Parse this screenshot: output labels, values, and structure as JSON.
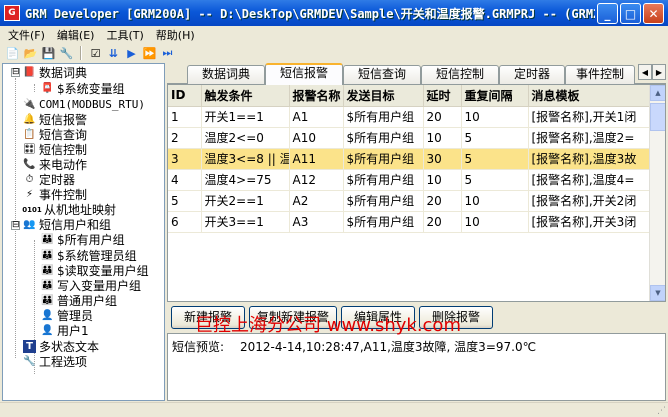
{
  "window": {
    "title": "GRM Developer [GRM200A] -- D:\\DeskTop\\GRMDEV\\Sample\\开关和温度报警.GRMPRJ -- (GRM200...",
    "icon_label": "G",
    "minimize": "_",
    "maximize": "□",
    "close": "✕"
  },
  "menubar": [
    {
      "label": "文件(F)"
    },
    {
      "label": "编辑(E)"
    },
    {
      "label": "工具(T)"
    },
    {
      "label": "帮助(H)"
    }
  ],
  "toolbar": [
    {
      "icon": "new-icon",
      "glyph": "📄"
    },
    {
      "icon": "open-icon",
      "glyph": "📂"
    },
    {
      "icon": "save-icon",
      "glyph": "💾"
    },
    {
      "icon": "tools-icon",
      "glyph": "🔧"
    },
    {
      "icon": "checklist-icon",
      "glyph": "☑"
    },
    {
      "icon": "download-icon",
      "glyph": "⇊"
    },
    {
      "icon": "play-icon",
      "glyph": "▶"
    },
    {
      "icon": "forward-icon",
      "glyph": "⏩"
    },
    {
      "icon": "step-icon",
      "glyph": "⏭"
    }
  ],
  "tree": [
    {
      "label": "数据词典",
      "icon": "book-icon",
      "glyph": "📕",
      "level": 0,
      "expander": "⊟"
    },
    {
      "label": "$系统变量组",
      "icon": "variable-group-icon",
      "glyph": "📮",
      "level": 1
    },
    {
      "label": "COM1(MODBUS_RTU)",
      "icon": "serial-port-icon",
      "glyph": "🔌",
      "level": 0
    },
    {
      "label": "短信报警",
      "icon": "bell-icon",
      "glyph": "🔔",
      "level": 0
    },
    {
      "label": "短信查询",
      "icon": "query-icon",
      "glyph": "📋",
      "level": 0
    },
    {
      "label": "短信控制",
      "icon": "control-icon",
      "glyph": "🎛",
      "level": 0
    },
    {
      "label": "来电动作",
      "icon": "phone-icon",
      "glyph": "📞",
      "level": 0
    },
    {
      "label": "定时器",
      "icon": "clock-icon",
      "glyph": "⏱",
      "level": 0
    },
    {
      "label": "事件控制",
      "icon": "event-icon",
      "glyph": "⚡",
      "level": 0
    },
    {
      "label": "从机地址映射",
      "icon": "address-map-icon",
      "glyph": "0101",
      "level": 0
    },
    {
      "label": "短信用户和组",
      "icon": "users-icon",
      "glyph": "👥",
      "level": 0,
      "expander": "⊟"
    },
    {
      "label": "$所有用户组",
      "icon": "user-group-icon",
      "glyph": "👪",
      "level": 1
    },
    {
      "label": "$系统管理员组",
      "icon": "user-group-icon",
      "glyph": "👪",
      "level": 1
    },
    {
      "label": "$读取变量用户组",
      "icon": "user-group-icon",
      "glyph": "👪",
      "level": 1
    },
    {
      "label": "写入变量用户组",
      "icon": "user-group-icon",
      "glyph": "👪",
      "level": 1
    },
    {
      "label": "普通用户组",
      "icon": "user-group-icon",
      "glyph": "👪",
      "level": 1
    },
    {
      "label": "管理员",
      "icon": "user-icon",
      "glyph": "👤",
      "level": 1
    },
    {
      "label": "用户1",
      "icon": "user-icon",
      "glyph": "👤",
      "level": 1
    },
    {
      "label": "多状态文本",
      "icon": "text-icon",
      "glyph": "T",
      "level": 0
    },
    {
      "label": "工程选项",
      "icon": "wrench-icon",
      "glyph": "🔧",
      "level": 0
    }
  ],
  "tabs": [
    {
      "label": "数据词典",
      "active": false
    },
    {
      "label": "短信报警",
      "active": true
    },
    {
      "label": "短信查询",
      "active": false
    },
    {
      "label": "短信控制",
      "active": false
    },
    {
      "label": "定时器",
      "active": false
    },
    {
      "label": "事件控制",
      "active": false
    }
  ],
  "alarm_table": {
    "columns": [
      "ID",
      "触发条件",
      "报警名称",
      "发送目标",
      "延时",
      "重复间隔",
      "消息模板"
    ],
    "rows": [
      [
        "1",
        "开关1==1",
        "A1",
        "$所有用户组",
        "20",
        "10",
        "[报警名称],开关1闭"
      ],
      [
        "2",
        "温度2<=0",
        "A10",
        "$所有用户组",
        "10",
        "5",
        "[报警名称],温度2="
      ],
      [
        "3",
        "温度3<=8 || 温",
        "A11",
        "$所有用户组",
        "30",
        "5",
        "[报警名称],温度3故"
      ],
      [
        "4",
        "温度4>=75",
        "A12",
        "$所有用户组",
        "10",
        "5",
        "[报警名称],温度4="
      ],
      [
        "5",
        "开关2==1",
        "A2",
        "$所有用户组",
        "20",
        "10",
        "[报警名称],开关2闭"
      ],
      [
        "6",
        "开关3==1",
        "A3",
        "$所有用户组",
        "20",
        "10",
        "[报警名称],开关3闭"
      ]
    ],
    "selected_row": 2
  },
  "buttons": {
    "new_alarm": "新建报警",
    "copy_new_alarm": "复制新建报警",
    "edit_props": "编辑属性",
    "delete_alarm": "删除报警"
  },
  "preview": {
    "label": "短信预览:",
    "text": "2012-4-14,10:28:47,A11,温度3故障, 温度3=97.0℃"
  },
  "watermark": "巨控上海分公司 www.shyk.com",
  "colors": {
    "titlebar": "#0a57d8",
    "selected_row": "#fbe38a",
    "active_tab_accent": "#f9b32e",
    "watermark": "#e00000"
  }
}
